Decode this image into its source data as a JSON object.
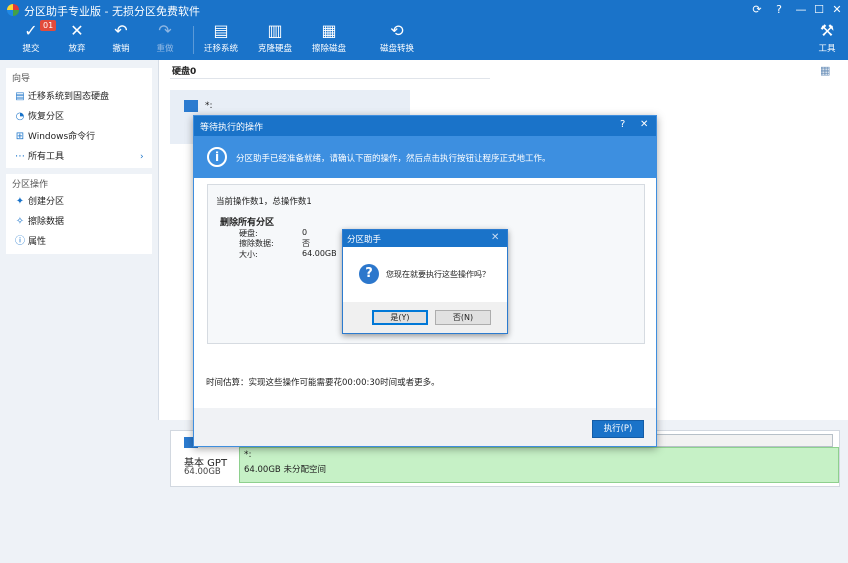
{
  "window": {
    "title": "分区助手专业版 - 无损分区免费软件",
    "controls": [
      "⟳",
      "?",
      "—",
      "☐",
      "✕"
    ]
  },
  "toolbar": {
    "badge": "01",
    "buttons": [
      {
        "label": "提交",
        "icon": "✓"
      },
      {
        "label": "放弃",
        "icon": "✕"
      },
      {
        "label": "撤销",
        "icon": "↶"
      },
      {
        "label": "重做",
        "icon": "↷"
      },
      {
        "label": "迁移系统",
        "icon": "▤"
      },
      {
        "label": "克隆硬盘",
        "icon": "▥"
      },
      {
        "label": "擦除磁盘",
        "icon": "▦"
      },
      {
        "label": "磁盘转换",
        "icon": "⟲"
      },
      {
        "label": "工具",
        "icon": "⚒"
      }
    ]
  },
  "sidebar": {
    "wizard_title": "向导",
    "wizard_items": [
      {
        "label": "迁移系统到固态硬盘",
        "icon": "▤"
      },
      {
        "label": "恢复分区",
        "icon": "◔"
      },
      {
        "label": "Windows命令行",
        "icon": "⊞"
      },
      {
        "label": "所有工具",
        "icon": "⋯",
        "arrow": "›"
      }
    ],
    "ops_title": "分区操作",
    "ops_items": [
      {
        "label": "创建分区",
        "icon": "✦"
      },
      {
        "label": "擦除数据",
        "icon": "✧"
      },
      {
        "label": "属性",
        "icon": "ⓘ"
      }
    ]
  },
  "main": {
    "disk_label": "硬盘0",
    "disk_partition": "*:",
    "view_toggle_icon": "▦"
  },
  "bottom_disk": {
    "type": "基本 GPT",
    "capacity": "64.00GB",
    "partition_name": "*:",
    "partition_desc": "64.00GB 未分配空间"
  },
  "dialog": {
    "title": "等待执行的操作",
    "help": "?",
    "close": "✕",
    "info": "分区助手已经准备就绪，请确认下面的操作，然后点击执行按钮让程序正式地工作。",
    "summary": "当前操作数1，总操作数1",
    "op_title": "删除所有分区",
    "op_fields": [
      {
        "k": "硬盘:",
        "v": "0"
      },
      {
        "k": "擦除数据:",
        "v": "否"
      },
      {
        "k": "大小:",
        "v": "64.00GB"
      }
    ],
    "time_estimate": "时间估算：实现这些操作可能需要花00:00:30时间或者更多。",
    "execute": "执行(P)"
  },
  "confirm": {
    "title": "分区助手",
    "close": "✕",
    "question": "您现在就要执行这些操作吗？",
    "yes": "是(Y)",
    "no": "否(N)"
  },
  "colors": {
    "accent": "#1a73c9",
    "partition_fill": "#c6f1c6"
  }
}
